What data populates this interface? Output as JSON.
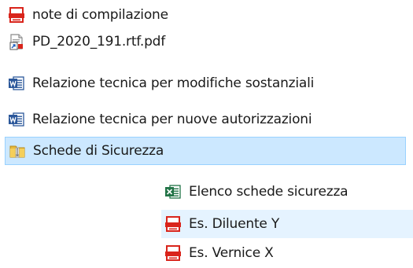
{
  "file_list": {
    "items": [
      {
        "label": "note di compilazione",
        "icon": "pdf-icon",
        "selected": false,
        "hover": false
      },
      {
        "label": "PD_2020_191.rtf.pdf",
        "icon": "pdf-shortcut-icon",
        "selected": false,
        "hover": false
      },
      {
        "label": "Relazione tecnica  per modifiche sostanziali",
        "icon": "word-document-icon",
        "selected": false,
        "hover": false
      },
      {
        "label": "Relazione tecnica per nuove autorizzazioni",
        "icon": "word-document-icon",
        "selected": false,
        "hover": false
      },
      {
        "label": "Schede di Sicurezza",
        "icon": "zip-folder-icon",
        "selected": true,
        "hover": false
      },
      {
        "label": "Elenco schede sicurezza",
        "icon": "excel-spreadsheet-icon",
        "selected": false,
        "hover": false
      },
      {
        "label": "Es. Diluente Y",
        "icon": "pdf-icon",
        "selected": false,
        "hover": true
      },
      {
        "label": "Es. Vernice X",
        "icon": "pdf-icon",
        "selected": false,
        "hover": false
      }
    ]
  },
  "colors": {
    "selection_background": "#cce8ff",
    "selection_border": "#99d1ff",
    "hover_background": "#e5f3ff",
    "pdf_red": "#d9241b",
    "word_blue": "#2b579a",
    "excel_green": "#217346",
    "zip_yellow": "#e8b93a"
  }
}
